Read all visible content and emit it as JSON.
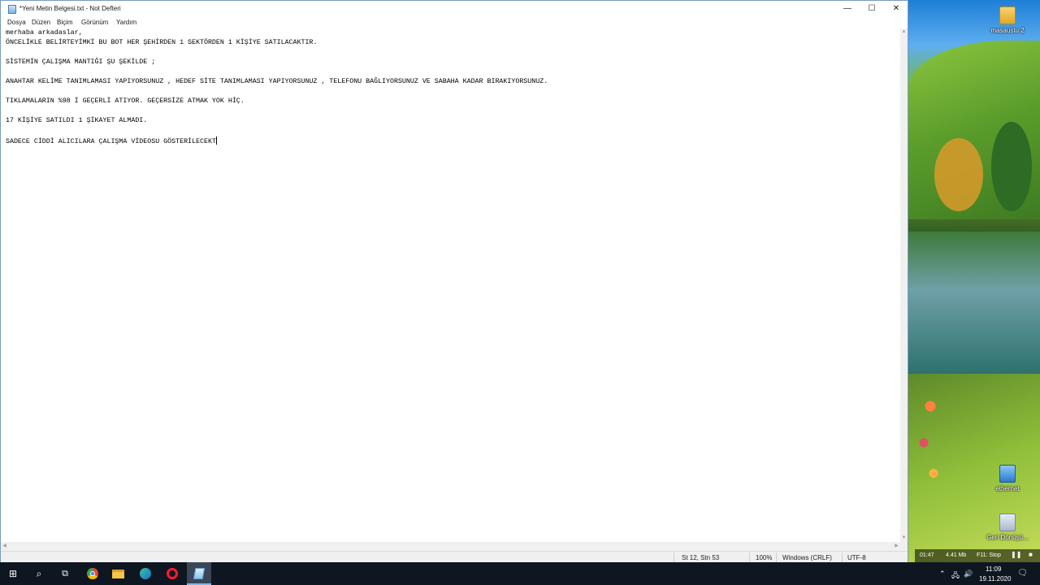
{
  "window": {
    "title": "*Yeni Metin Belgesi.txt - Not Defteri",
    "minimize": "—",
    "maximize": "☐",
    "close": "✕"
  },
  "menu": [
    "Dosya",
    "Düzen",
    "Biçim",
    "Görünüm",
    "Yardım"
  ],
  "editor": {
    "lines": [
      "merhaba arkadaslar,",
      "ÖNCELİKLE BELİRTEYİMKİ BU BOT HER ŞEHİRDEN 1 SEKTÖRDEN 1 KİŞİYE SATILACAKTIR.",
      "",
      "SİSTEMİN ÇALIŞMA MANTIĞI ŞU ŞEKİLDE ;",
      "",
      "ANAHTAR KELİME TANIMLAMASI YAPIYORSUNUZ , HEDEF SİTE TANIMLAMASI YAPIYORSUNUZ , TELEFONU BAĞLIYORSUNUZ VE SABAHA KADAR BIRAKIYORSUNUZ.",
      "",
      "TIKLAMALARIN %98 İ GEÇERLİ ATIYOR. GEÇERSİZE ATMAK YOK HİÇ.",
      "",
      "17 KİŞİYE SATILDI 1 ŞİKAYET ALMADI.",
      "",
      "SADECE CİDDİ ALICILARA ÇALIŞMA VİDEOSU GÖSTERİLECEKT"
    ]
  },
  "status": {
    "position": "St 12, Stn 53",
    "zoom": "100%",
    "line_ending": "Windows (CRLF)",
    "encoding": "UTF-8"
  },
  "recorder": {
    "time": "01:47",
    "size": "4.41 Mb",
    "hotkey": "F11: Stop"
  },
  "desktop": {
    "icons": [
      {
        "label": "masaustu 2",
        "icon": "folder-icon"
      },
      {
        "label": "ethernet",
        "icon": "network-icon"
      },
      {
        "label": "Geri Dönüşü...",
        "icon": "recycle-bin-icon"
      }
    ]
  },
  "taskbar": {
    "clock_time": "11:09",
    "clock_date": "19.11.2020"
  }
}
